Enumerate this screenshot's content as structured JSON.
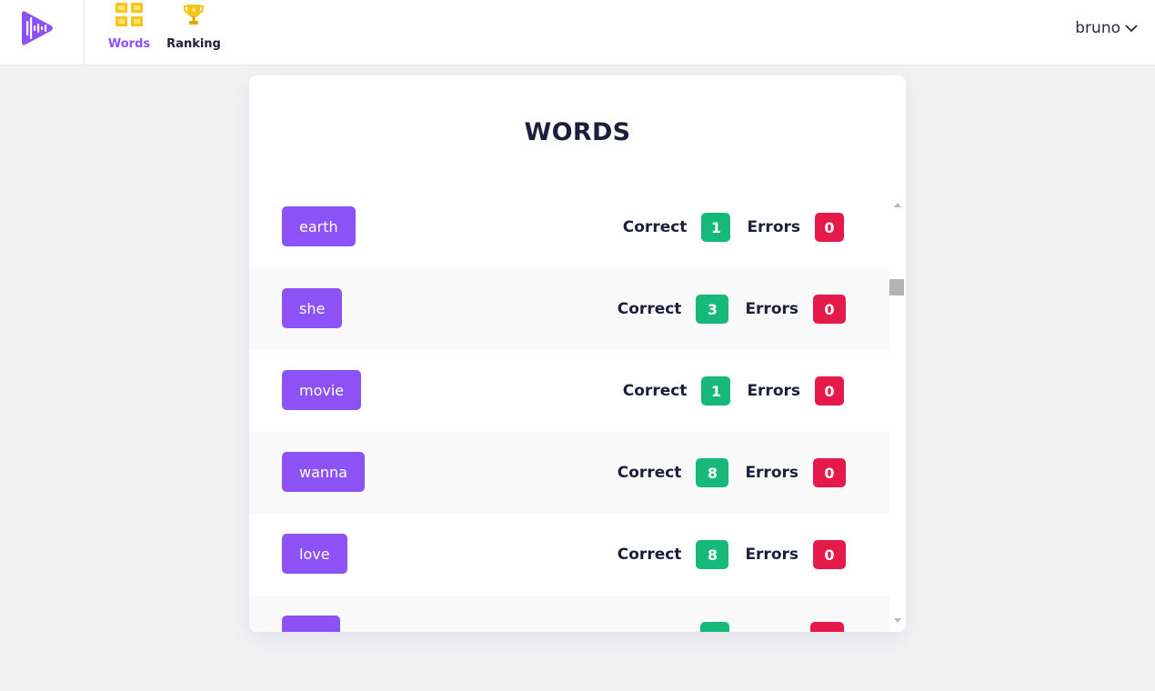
{
  "nav": {
    "items": [
      {
        "label": "Words",
        "icon": "grid-icon",
        "active": true
      },
      {
        "label": "Ranking",
        "icon": "trophy-icon",
        "active": false
      }
    ]
  },
  "user": {
    "name": "bruno",
    "icon": "chevron-down-icon"
  },
  "card": {
    "title": "WORDS"
  },
  "labels": {
    "correct": "Correct",
    "errors": "Errors"
  },
  "words": [
    {
      "word": "earth",
      "correct": "1",
      "errors": "0"
    },
    {
      "word": "she",
      "correct": "3",
      "errors": "0"
    },
    {
      "word": "movie",
      "correct": "1",
      "errors": "0"
    },
    {
      "word": "wanna",
      "correct": "8",
      "errors": "0"
    },
    {
      "word": "love",
      "correct": "8",
      "errors": "0"
    },
    {
      "word": "",
      "correct": "",
      "errors": ""
    }
  ],
  "colors": {
    "accent": "#8c52f5",
    "correct": "#16b97a",
    "errors": "#e5194a",
    "nav_icon": "#f5c518",
    "text": "#1c1f3b"
  }
}
